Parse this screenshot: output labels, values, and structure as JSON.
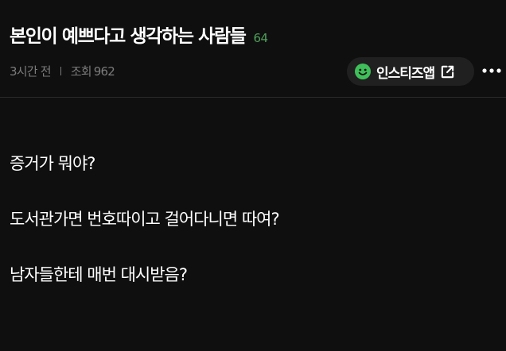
{
  "post": {
    "title": "본인이 예쁘다고 생각하는 사람들",
    "comment_count": "64",
    "time_ago": "3시간 전",
    "views_label": "조회",
    "views_count": "962",
    "source": {
      "name": "인스티즈앱",
      "icon": "smiley-icon",
      "icon_color": "#3fbf5a"
    },
    "more_icon": "more-dots-icon",
    "body_lines": [
      "증거가 뭐야?",
      "도서관가면 번호따이고 걸어다니면 따여?",
      "남자들한테 매번 대시받음?"
    ]
  },
  "colors": {
    "background": "#0f0f0f",
    "text": "#ffffff",
    "muted": "#7b7b7b",
    "accent_green": "#4f9e5a",
    "pill": "#202020"
  }
}
